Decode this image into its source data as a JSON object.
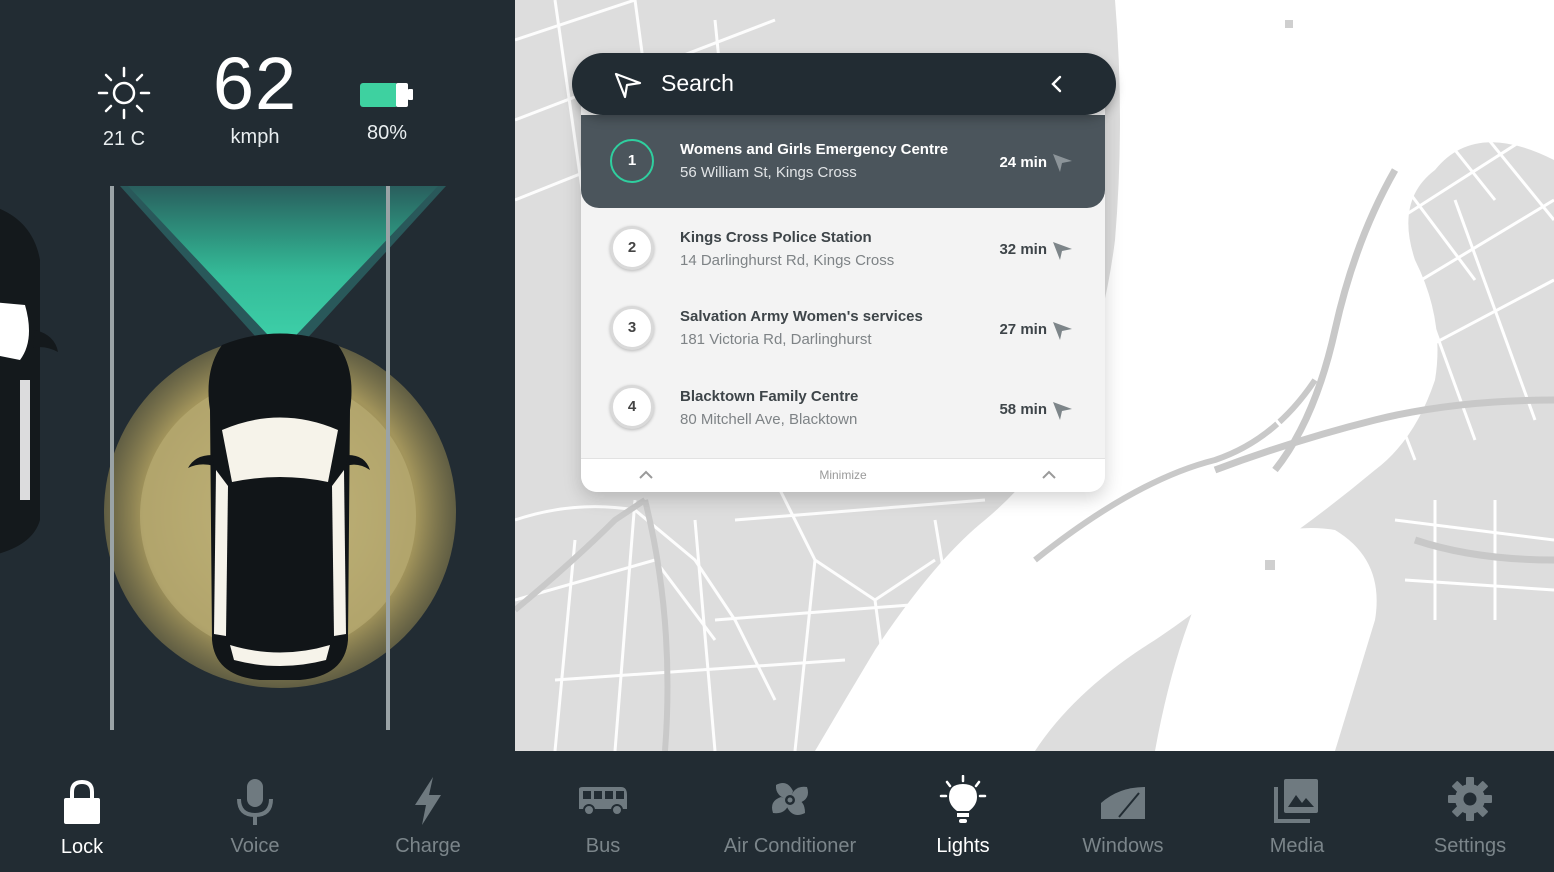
{
  "dashboard": {
    "temperature": {
      "value": "21 C",
      "icon": "sun-icon"
    },
    "speed": {
      "value": "62",
      "unit": "kmph"
    },
    "battery": {
      "value": "80%",
      "icon": "battery-icon",
      "color": "#3ed1a0"
    },
    "accent_color": "#2fcf9f",
    "headlight_color": "#c9bb7a"
  },
  "search": {
    "label": "Search",
    "results": [
      {
        "number": "1",
        "title": "Womens and Girls Emergency Centre",
        "address": "56 William St, Kings Cross",
        "time": "24 min",
        "selected": true
      },
      {
        "number": "2",
        "title": "Kings Cross Police Station",
        "address": "14 Darlinghurst Rd, Kings Cross",
        "time": "32 min",
        "selected": false
      },
      {
        "number": "3",
        "title": "Salvation Army Women's services",
        "address": "181 Victoria Rd, Darlinghurst",
        "time": "27 min",
        "selected": false
      },
      {
        "number": "4",
        "title": "Blacktown Family Centre",
        "address": "80 Mitchell Ave, Blacktown",
        "time": "58 min",
        "selected": false
      }
    ],
    "minimize_label": "Minimize"
  },
  "bottom_nav": [
    {
      "label": "Lock",
      "icon": "lock-icon",
      "active": true
    },
    {
      "label": "Voice",
      "icon": "microphone-icon",
      "active": false
    },
    {
      "label": "Charge",
      "icon": "lightning-icon",
      "active": false
    },
    {
      "label": "Bus",
      "icon": "bus-icon",
      "active": false
    },
    {
      "label": "Air Conditioner",
      "icon": "fan-icon",
      "active": false
    },
    {
      "label": "Lights",
      "icon": "lightbulb-icon",
      "active": true
    },
    {
      "label": "Windows",
      "icon": "window-icon",
      "active": false
    },
    {
      "label": "Media",
      "icon": "media-icon",
      "active": false
    },
    {
      "label": "Settings",
      "icon": "gear-icon",
      "active": false
    }
  ]
}
